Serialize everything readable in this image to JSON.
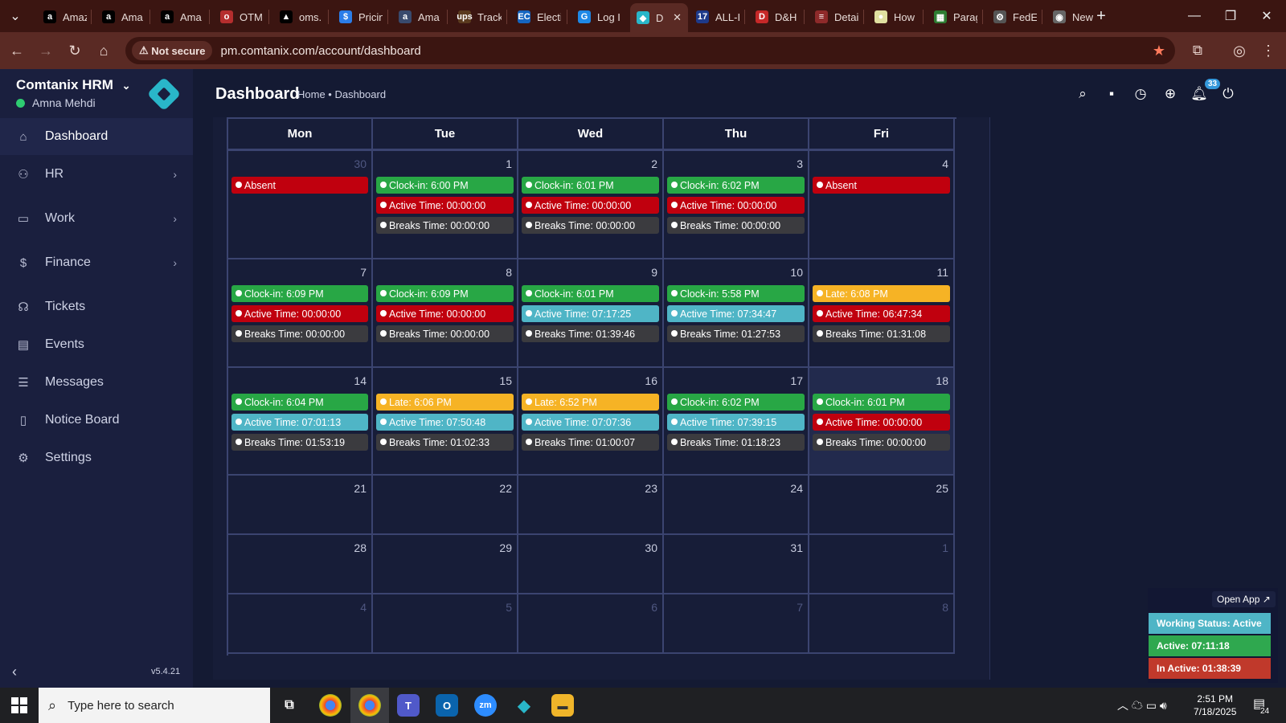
{
  "browser": {
    "tabs": [
      {
        "title": "Amaz",
        "icon": "a",
        "color": "#000000"
      },
      {
        "title": "Ama",
        "icon": "a",
        "color": "#000000"
      },
      {
        "title": "Ama",
        "icon": "a",
        "color": "#000000"
      },
      {
        "title": "OTM",
        "icon": "o",
        "color": "#b52e2e"
      },
      {
        "title": "oms.",
        "icon": "▲",
        "color": "#000000"
      },
      {
        "title": "Pricin",
        "icon": "$",
        "color": "#2b7de9"
      },
      {
        "title": "Ama",
        "icon": "a",
        "color": "#394a6d"
      },
      {
        "title": "Track",
        "icon": "ups",
        "color": "#5a3a1e"
      },
      {
        "title": "Electi",
        "icon": "EC",
        "color": "#1565c0"
      },
      {
        "title": "Log I",
        "icon": "G",
        "color": "#1e88e5"
      },
      {
        "title": "D",
        "icon": "◆",
        "color": "#29b6c9"
      },
      {
        "title": "ALL-I",
        "icon": "17",
        "color": "#1e3a8a"
      },
      {
        "title": "D&H",
        "icon": "D",
        "color": "#c62828"
      },
      {
        "title": "Detai",
        "icon": "≡",
        "color": "#8e2a2a"
      },
      {
        "title": "How",
        "icon": "●",
        "color": "#e0e0a0"
      },
      {
        "title": "Parag",
        "icon": "▦",
        "color": "#2e7d32"
      },
      {
        "title": "FedE",
        "icon": "⚙",
        "color": "#555555"
      },
      {
        "title": "New",
        "icon": "◉",
        "color": "#666666"
      }
    ],
    "not_secure": "Not secure",
    "url": "pm.comtanix.com/account/dashboard"
  },
  "sidebar": {
    "brand": "Comtanix HRM",
    "user": "Amna Mehdi",
    "items": [
      {
        "label": "Dashboard",
        "icon": "home-icon"
      },
      {
        "label": "HR",
        "icon": "users-icon"
      },
      {
        "label": "Work",
        "icon": "briefcase-icon"
      },
      {
        "label": "Finance",
        "icon": "dollar-icon"
      },
      {
        "label": "Tickets",
        "icon": "headset-icon"
      },
      {
        "label": "Events",
        "icon": "calendar-icon"
      },
      {
        "label": "Messages",
        "icon": "message-icon"
      },
      {
        "label": "Notice Board",
        "icon": "clipboard-icon"
      },
      {
        "label": "Settings",
        "icon": "gear-icon"
      }
    ],
    "version": "v5.4.21"
  },
  "header": {
    "title": "Dashboard",
    "breadcrumb": "Home • Dashboard",
    "notification_count": "33"
  },
  "calendar": {
    "days": [
      "Mon",
      "Tue",
      "Wed",
      "Thu",
      "Fri"
    ],
    "weeks": [
      [
        {
          "d": "30",
          "dim": true,
          "ev": [
            {
              "t": "Absent",
              "c": "red"
            }
          ]
        },
        {
          "d": "1",
          "ev": [
            {
              "t": "Clock-in: 6:00 PM",
              "c": "green"
            },
            {
              "t": "Active Time: 00:00:00",
              "c": "red"
            },
            {
              "t": "Breaks Time: 00:00:00",
              "c": "gray"
            }
          ]
        },
        {
          "d": "2",
          "ev": [
            {
              "t": "Clock-in: 6:01 PM",
              "c": "green"
            },
            {
              "t": "Active Time: 00:00:00",
              "c": "red"
            },
            {
              "t": "Breaks Time: 00:00:00",
              "c": "gray"
            }
          ]
        },
        {
          "d": "3",
          "ev": [
            {
              "t": "Clock-in: 6:02 PM",
              "c": "green"
            },
            {
              "t": "Active Time: 00:00:00",
              "c": "red"
            },
            {
              "t": "Breaks Time: 00:00:00",
              "c": "gray"
            }
          ]
        },
        {
          "d": "4",
          "ev": [
            {
              "t": "Absent",
              "c": "red"
            }
          ]
        }
      ],
      [
        {
          "d": "7",
          "ev": [
            {
              "t": "Clock-in: 6:09 PM",
              "c": "green"
            },
            {
              "t": "Active Time: 00:00:00",
              "c": "red"
            },
            {
              "t": "Breaks Time: 00:00:00",
              "c": "gray"
            }
          ]
        },
        {
          "d": "8",
          "ev": [
            {
              "t": "Clock-in: 6:09 PM",
              "c": "green"
            },
            {
              "t": "Active Time: 00:00:00",
              "c": "red"
            },
            {
              "t": "Breaks Time: 00:00:00",
              "c": "gray"
            }
          ]
        },
        {
          "d": "9",
          "ev": [
            {
              "t": "Clock-in: 6:01 PM",
              "c": "green"
            },
            {
              "t": "Active Time: 07:17:25",
              "c": "cyan"
            },
            {
              "t": "Breaks Time: 01:39:46",
              "c": "gray"
            }
          ]
        },
        {
          "d": "10",
          "ev": [
            {
              "t": "Clock-in: 5:58 PM",
              "c": "green"
            },
            {
              "t": "Active Time: 07:34:47",
              "c": "cyan"
            },
            {
              "t": "Breaks Time: 01:27:53",
              "c": "gray"
            }
          ]
        },
        {
          "d": "11",
          "ev": [
            {
              "t": "Late: 6:08 PM",
              "c": "orange"
            },
            {
              "t": "Active Time: 06:47:34",
              "c": "red"
            },
            {
              "t": "Breaks Time: 01:31:08",
              "c": "gray"
            }
          ]
        }
      ],
      [
        {
          "d": "14",
          "ev": [
            {
              "t": "Clock-in: 6:04 PM",
              "c": "green"
            },
            {
              "t": "Active Time: 07:01:13",
              "c": "cyan"
            },
            {
              "t": "Breaks Time: 01:53:19",
              "c": "gray"
            }
          ]
        },
        {
          "d": "15",
          "ev": [
            {
              "t": "Late: 6:06 PM",
              "c": "orange"
            },
            {
              "t": "Active Time: 07:50:48",
              "c": "cyan"
            },
            {
              "t": "Breaks Time: 01:02:33",
              "c": "gray"
            }
          ]
        },
        {
          "d": "16",
          "ev": [
            {
              "t": "Late: 6:52 PM",
              "c": "orange"
            },
            {
              "t": "Active Time: 07:07:36",
              "c": "cyan"
            },
            {
              "t": "Breaks Time: 01:00:07",
              "c": "gray"
            }
          ]
        },
        {
          "d": "17",
          "ev": [
            {
              "t": "Clock-in: 6:02 PM",
              "c": "green"
            },
            {
              "t": "Active Time: 07:39:15",
              "c": "cyan"
            },
            {
              "t": "Breaks Time: 01:18:23",
              "c": "gray"
            }
          ]
        },
        {
          "d": "18",
          "today": true,
          "ev": [
            {
              "t": "Clock-in: 6:01 PM",
              "c": "green"
            },
            {
              "t": "Active Time: 00:00:00",
              "c": "red"
            },
            {
              "t": "Breaks Time: 00:00:00",
              "c": "gray"
            }
          ]
        }
      ],
      [
        {
          "d": "21",
          "ev": []
        },
        {
          "d": "22",
          "ev": []
        },
        {
          "d": "23",
          "ev": []
        },
        {
          "d": "24",
          "ev": []
        },
        {
          "d": "25",
          "ev": []
        }
      ],
      [
        {
          "d": "28",
          "ev": []
        },
        {
          "d": "29",
          "ev": []
        },
        {
          "d": "30",
          "ev": []
        },
        {
          "d": "31",
          "ev": []
        },
        {
          "d": "1",
          "dim": true,
          "ev": []
        }
      ],
      [
        {
          "d": "4",
          "dim": true,
          "ev": []
        },
        {
          "d": "5",
          "dim": true,
          "ev": []
        },
        {
          "d": "6",
          "dim": true,
          "ev": []
        },
        {
          "d": "7",
          "dim": true,
          "ev": []
        },
        {
          "d": "8",
          "dim": true,
          "ev": []
        }
      ]
    ]
  },
  "status_widget": {
    "open_app": "Open App ↗",
    "working_status": "Working Status: Active",
    "active": "Active: 07:11:18",
    "inactive": "In Active: 01:38:39"
  },
  "taskbar": {
    "search_placeholder": "Type here to search",
    "time": "2:51 PM",
    "date": "7/18/2025",
    "notif": "24"
  },
  "colors": {
    "green": "#28a745",
    "red": "#c0000e",
    "cyan": "#4fb5c6",
    "gray": "#3b3b3f",
    "orange": "#f6b325",
    "stat_status": "#4fb5c6",
    "stat_active": "#2fa84f",
    "stat_inactive": "#c0392b"
  }
}
